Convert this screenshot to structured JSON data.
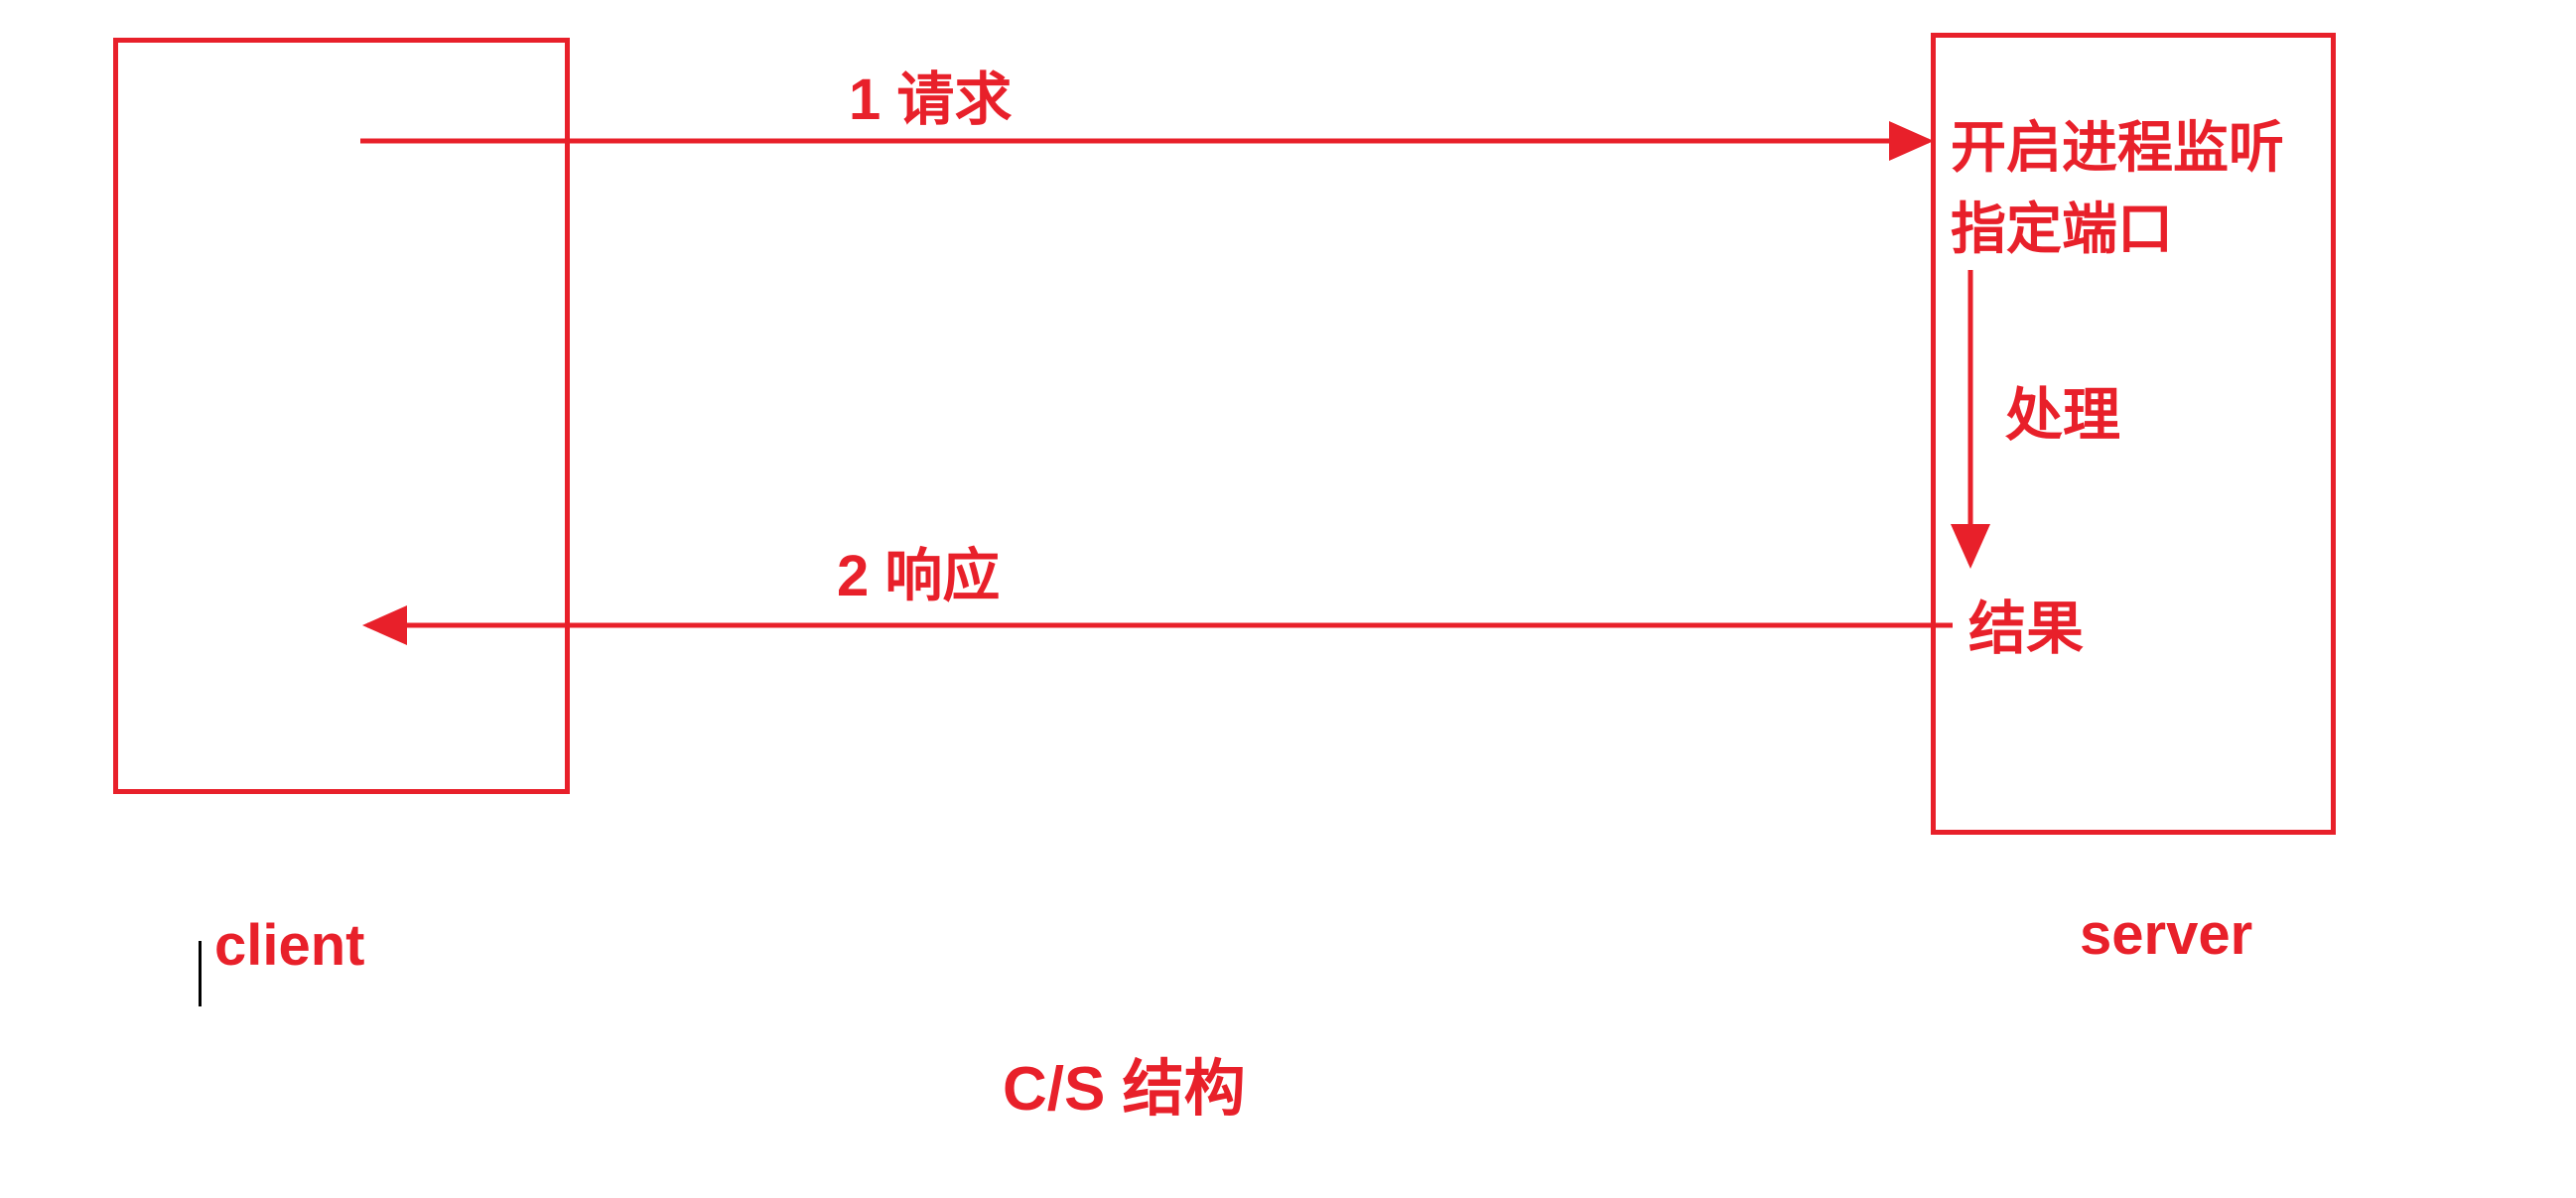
{
  "diagram": {
    "colors": {
      "accent": "#e8202a",
      "background": "#ffffff",
      "cursor": "#000000"
    },
    "client": {
      "label": "client"
    },
    "server": {
      "label": "server",
      "title": "开启进程监听指定端口",
      "process_label": "处理",
      "result_label": "结果"
    },
    "request_arrow": {
      "label": "1  请求"
    },
    "response_arrow": {
      "label": "2  响应"
    },
    "caption": "C/S  结构"
  }
}
